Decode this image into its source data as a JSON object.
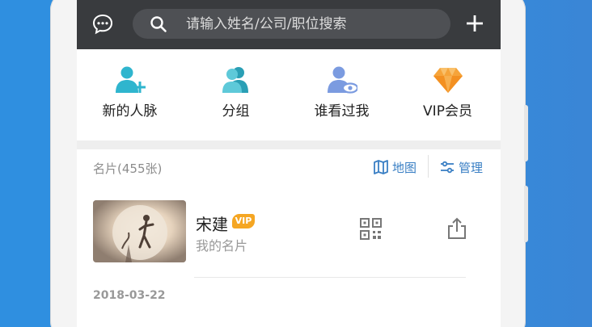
{
  "search": {
    "placeholder": "请输入姓名/公司/职位搜索"
  },
  "actions": [
    {
      "label": "新的人脉",
      "icon": "person-add-icon"
    },
    {
      "label": "分组",
      "icon": "group-icon"
    },
    {
      "label": "谁看过我",
      "icon": "viewer-icon"
    },
    {
      "label": "VIP会员",
      "icon": "diamond-icon"
    }
  ],
  "cards": {
    "count_label": "名片(455张)",
    "map_label": "地图",
    "manage_label": "管理"
  },
  "card": {
    "name": "宋建",
    "badge": "VIP",
    "subtitle": "我的名片"
  },
  "date": "2018-03-22",
  "colors": {
    "topbar": "#393b3e",
    "accent_teal": "#2fb5ce",
    "accent_orange": "#f5a623",
    "link_blue": "#3a7fc4"
  }
}
